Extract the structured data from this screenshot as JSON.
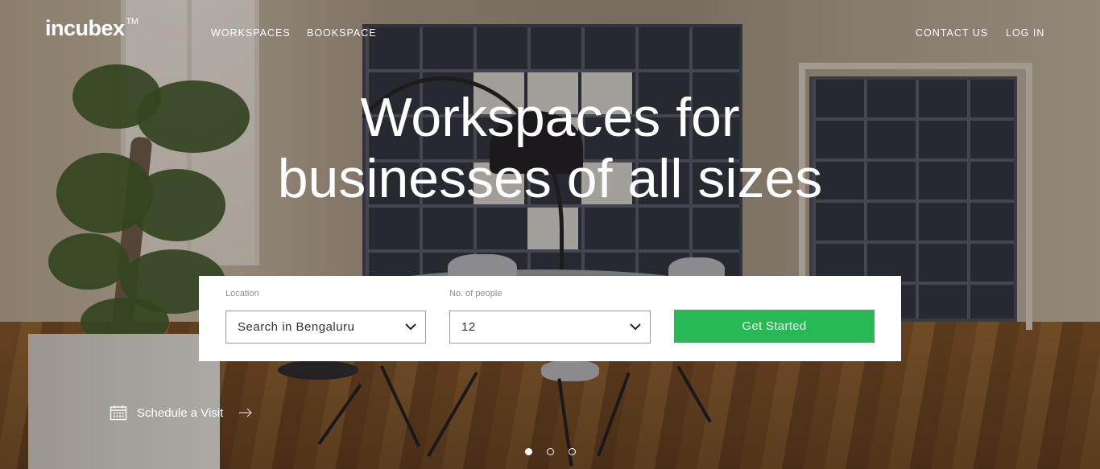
{
  "brand": {
    "name": "incubex",
    "mark": "TM"
  },
  "nav": {
    "left": [
      {
        "label": "WORKSPACES"
      },
      {
        "label": "BOOKSPACE"
      }
    ],
    "right": [
      {
        "label": "CONTACT US"
      },
      {
        "label": "LOG IN"
      }
    ]
  },
  "hero": {
    "line1": "Workspaces for",
    "line2": "businesses of all sizes"
  },
  "search": {
    "location": {
      "label": "Location",
      "value": "Search in Bengaluru"
    },
    "people": {
      "label": "No. of people",
      "value": "12"
    },
    "cta_label": "Get Started"
  },
  "schedule": {
    "label": "Schedule a Visit",
    "icon": "calendar-icon",
    "arrow": "arrow-right-icon"
  },
  "carousel": {
    "count": 3,
    "active_index": 0
  },
  "colors": {
    "cta": "#27b954",
    "text_on_hero": "#ffffff"
  }
}
